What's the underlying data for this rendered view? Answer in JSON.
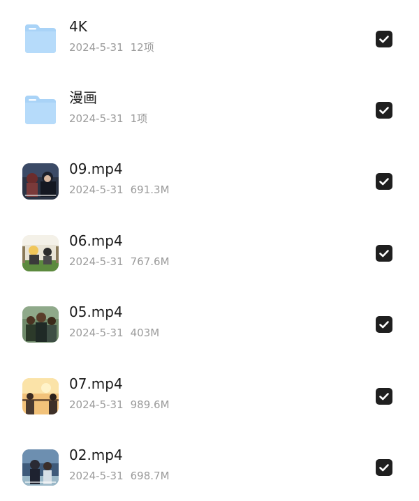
{
  "items": [
    {
      "name": "4K",
      "date": "2024-5-31",
      "size": "12项",
      "icon": "folder-icon"
    },
    {
      "name": "漫画",
      "date": "2024-5-31",
      "size": "1项",
      "icon": "folder-icon"
    },
    {
      "name": "09.mp4",
      "date": "2024-5-31",
      "size": "691.3M",
      "icon": "video-thumbnail"
    },
    {
      "name": "06.mp4",
      "date": "2024-5-31",
      "size": "767.6M",
      "icon": "video-thumbnail"
    },
    {
      "name": "05.mp4",
      "date": "2024-5-31",
      "size": "403M",
      "icon": "video-thumbnail"
    },
    {
      "name": "07.mp4",
      "date": "2024-5-31",
      "size": "989.6M",
      "icon": "video-thumbnail"
    },
    {
      "name": "02.mp4",
      "date": "2024-5-31",
      "size": "698.7M",
      "icon": "video-thumbnail"
    }
  ],
  "colors": {
    "folder": "#a9d3f7",
    "checkbox": "#1f1f1f",
    "name_text": "#1c1c1c",
    "meta_text": "#9b9b9b"
  }
}
